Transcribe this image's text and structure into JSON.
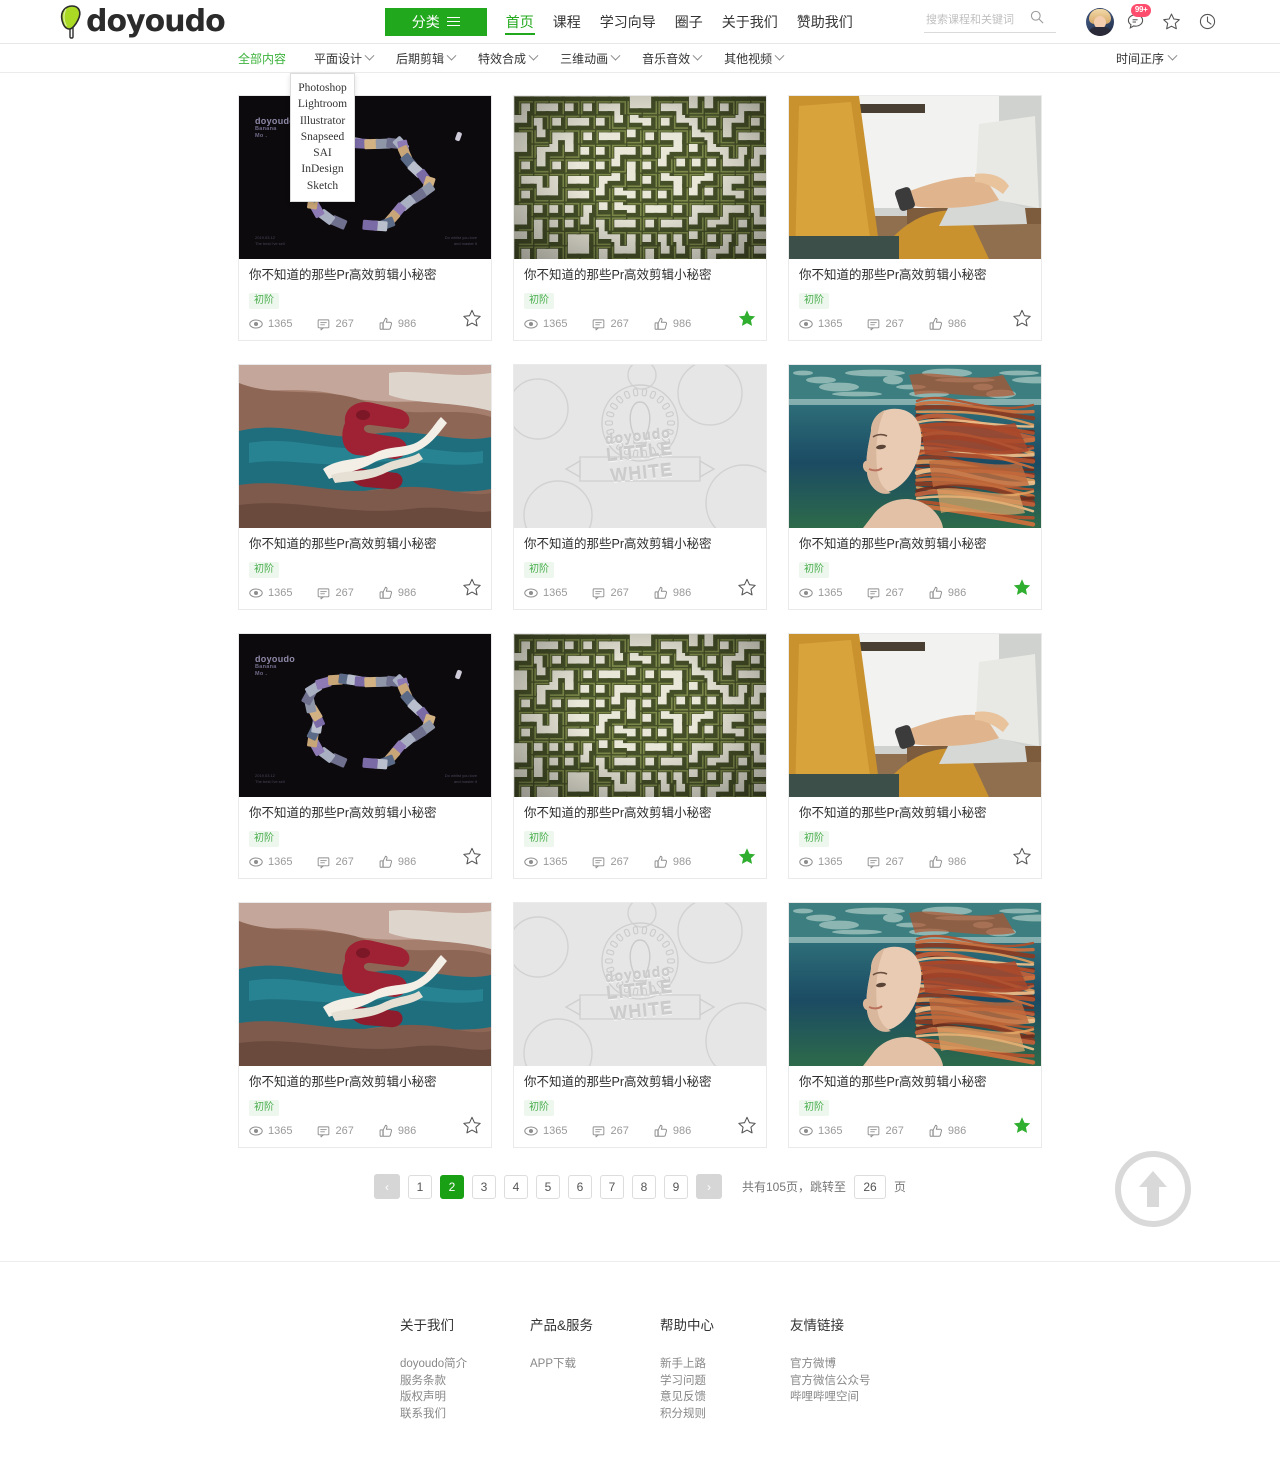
{
  "site": {
    "logo_text": "doyoudo"
  },
  "header": {
    "category_button": "分类",
    "nav": [
      {
        "label": "首页",
        "active": true
      },
      {
        "label": "课程",
        "active": false
      },
      {
        "label": "学习向导",
        "active": false
      },
      {
        "label": "圈子",
        "active": false
      },
      {
        "label": "关于我们",
        "active": false
      },
      {
        "label": "赞助我们",
        "active": false
      }
    ],
    "search": {
      "placeholder": "搜索课程和关键词",
      "value": ""
    },
    "message_badge": "99+",
    "icons": [
      "avatar",
      "message-icon",
      "star-icon",
      "history-icon"
    ]
  },
  "filterbar": {
    "items": [
      {
        "label": "全部内容",
        "has_chevron": false,
        "active": true
      },
      {
        "label": "平面设计",
        "has_chevron": true,
        "active": false
      },
      {
        "label": "后期剪辑",
        "has_chevron": true,
        "active": false
      },
      {
        "label": "特效合成",
        "has_chevron": true,
        "active": false
      },
      {
        "label": "三维动画",
        "has_chevron": true,
        "active": false
      },
      {
        "label": "音乐音效",
        "has_chevron": true,
        "active": false
      },
      {
        "label": "其他视频",
        "has_chevron": true,
        "active": false
      }
    ],
    "sort": "时间正序"
  },
  "dropdown": {
    "open_for": "平面设计",
    "items": [
      "Photoshop",
      "Lightroom",
      "Illustrator",
      "Snapseed",
      "SAI",
      "InDesign",
      "Sketch"
    ]
  },
  "thumb_text": {
    "banana_title": "doyoudo",
    "banana_sub1": "Banana",
    "banana_sub2": "Mo .",
    "banana_bl": "2019.03.12\nThe best i've sell",
    "banana_br": "Do whilst you love\nand master it",
    "white_brand": "doyoudo",
    "white_sub": "LITTLE WHITE"
  },
  "cards": [
    {
      "title": "你不知道的那些Pr高效剪辑小秘密",
      "level": "初阶",
      "views": "1365",
      "comments": "267",
      "likes": "986",
      "favorited": false,
      "art": "banana"
    },
    {
      "title": "你不知道的那些Pr高效剪辑小秘密",
      "level": "初阶",
      "views": "1365",
      "comments": "267",
      "likes": "986",
      "favorited": true,
      "art": "maze"
    },
    {
      "title": "你不知道的那些Pr高效剪辑小秘密",
      "level": "初阶",
      "views": "1365",
      "comments": "267",
      "likes": "986",
      "favorited": false,
      "art": "laptop"
    },
    {
      "title": "你不知道的那些Pr高效剪辑小秘密",
      "level": "初阶",
      "views": "1365",
      "comments": "267",
      "likes": "986",
      "favorited": false,
      "art": "lake"
    },
    {
      "title": "你不知道的那些Pr高效剪辑小秘密",
      "level": "初阶",
      "views": "1365",
      "comments": "267",
      "likes": "986",
      "favorited": false,
      "art": "white"
    },
    {
      "title": "你不知道的那些Pr高效剪辑小秘密",
      "level": "初阶",
      "views": "1365",
      "comments": "267",
      "likes": "986",
      "favorited": true,
      "art": "under"
    },
    {
      "title": "你不知道的那些Pr高效剪辑小秘密",
      "level": "初阶",
      "views": "1365",
      "comments": "267",
      "likes": "986",
      "favorited": false,
      "art": "banana"
    },
    {
      "title": "你不知道的那些Pr高效剪辑小秘密",
      "level": "初阶",
      "views": "1365",
      "comments": "267",
      "likes": "986",
      "favorited": true,
      "art": "maze"
    },
    {
      "title": "你不知道的那些Pr高效剪辑小秘密",
      "level": "初阶",
      "views": "1365",
      "comments": "267",
      "likes": "986",
      "favorited": false,
      "art": "laptop"
    },
    {
      "title": "你不知道的那些Pr高效剪辑小秘密",
      "level": "初阶",
      "views": "1365",
      "comments": "267",
      "likes": "986",
      "favorited": false,
      "art": "lake"
    },
    {
      "title": "你不知道的那些Pr高效剪辑小秘密",
      "level": "初阶",
      "views": "1365",
      "comments": "267",
      "likes": "986",
      "favorited": false,
      "art": "white"
    },
    {
      "title": "你不知道的那些Pr高效剪辑小秘密",
      "level": "初阶",
      "views": "1365",
      "comments": "267",
      "likes": "986",
      "favorited": true,
      "art": "under"
    }
  ],
  "pagination": {
    "prev": "‹",
    "next": "›",
    "pages": [
      "1",
      "2",
      "3",
      "4",
      "5",
      "6",
      "7",
      "8",
      "9"
    ],
    "current": "2",
    "total_text": "共有105页，跳转至",
    "jump_value": "26",
    "unit": "页"
  },
  "footer": {
    "columns": [
      {
        "title": "关于我们",
        "links": [
          "doyoudo简介",
          "服务条款",
          "版权声明",
          "联系我们"
        ]
      },
      {
        "title": "产品&服务",
        "links": [
          "APP下载"
        ]
      },
      {
        "title": "帮助中心",
        "links": [
          "新手上路",
          "学习问题",
          "意见反馈",
          "积分规则"
        ]
      },
      {
        "title": "友情链接",
        "links": [
          "官方微博",
          "官方微信公众号",
          "哔哩哔哩空间"
        ]
      }
    ]
  },
  "colors": {
    "brand_green": "#22a81c",
    "active_green": "#3cb33c",
    "badge_red": "#ff4d6d",
    "star_green": "#2fae2f"
  }
}
